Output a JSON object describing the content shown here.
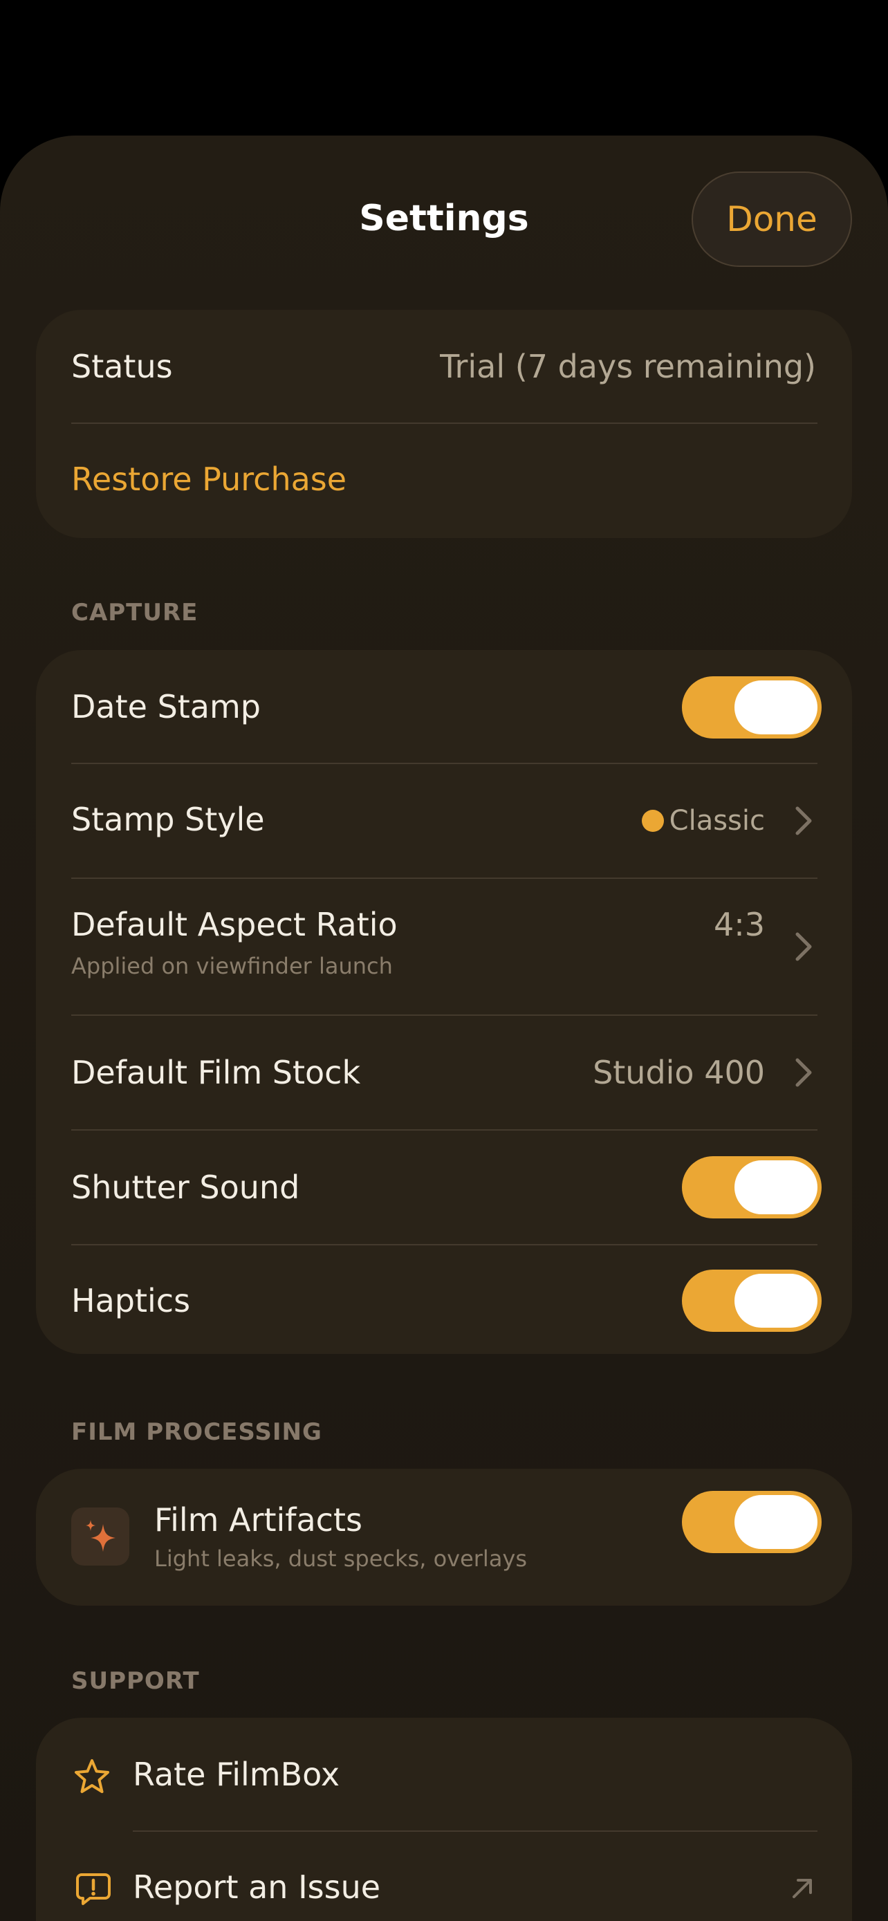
{
  "header": {
    "title": "Settings",
    "done_label": "Done"
  },
  "account": {
    "status_label": "Status",
    "status_value": "Trial (7 days remaining)",
    "restore_label": "Restore Purchase"
  },
  "capture": {
    "section_label": "CAPTURE",
    "date_stamp": {
      "label": "Date Stamp",
      "on": true
    },
    "stamp_style": {
      "label": "Stamp Style",
      "value": "Classic"
    },
    "aspect_ratio": {
      "label": "Default Aspect Ratio",
      "subtitle": "Applied on viewfinder launch",
      "value": "4:3"
    },
    "film_stock": {
      "label": "Default Film Stock",
      "value": "Studio 400"
    },
    "shutter_sound": {
      "label": "Shutter Sound",
      "on": true
    },
    "haptics": {
      "label": "Haptics",
      "on": true
    }
  },
  "film_processing": {
    "section_label": "FILM PROCESSING",
    "artifacts": {
      "label": "Film Artifacts",
      "subtitle": "Light leaks, dust specks, overlays",
      "on": true,
      "icon": "sparkles-icon"
    }
  },
  "support": {
    "section_label": "SUPPORT",
    "rate": {
      "label": "Rate FilmBox",
      "icon": "star-icon"
    },
    "report": {
      "label": "Report an Issue",
      "icon": "exclamation-bubble-icon"
    }
  },
  "colors": {
    "accent": "#eba734",
    "background": "#231d14",
    "card": "#2a2318"
  }
}
